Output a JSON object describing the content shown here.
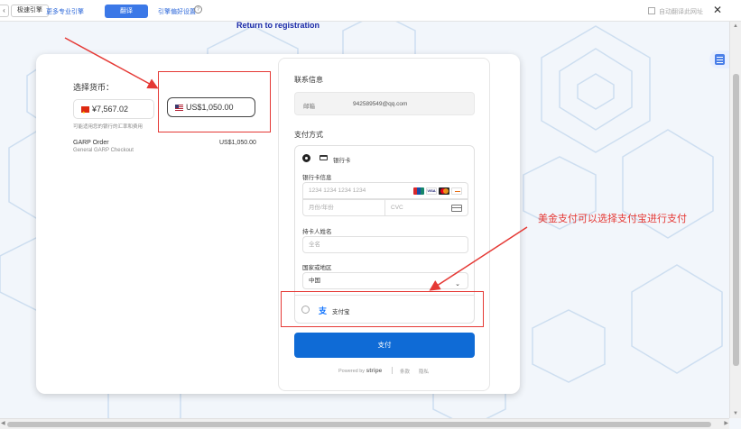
{
  "topbar": {
    "back_label": "‹",
    "engine_label": "极速引擎",
    "more_engines": "更多专业引擎",
    "translate_button": "翻译",
    "engine_settings": "引擎偏好设置",
    "help_glyph": "?",
    "auto_translate_label": "自动翻译此网址",
    "close_glyph": "✕"
  },
  "return_link": "Return to registration",
  "left_panel": {
    "currency_label": "选择货币：",
    "cny_value": "¥7,567.02",
    "usd_value": "US$1,050.00",
    "fx_note": "可能适用您的银行的汇率和费用",
    "order_name": "GARP Order",
    "order_desc": "General GARP Checkout",
    "order_price": "US$1,050.00"
  },
  "right_panel": {
    "contact_title": "联系信息",
    "email_label": "邮箱",
    "email_value": "942589549@qq.com",
    "payment_title": "支付方式",
    "bank_card_label": "银行卡",
    "card_info_label": "银行卡信息",
    "card_number_placeholder": "1234 1234 1234 1234",
    "expiry_placeholder": "月份/年份",
    "cvc_placeholder": "CVC",
    "cardholder_label": "持卡人姓名",
    "cardholder_placeholder": "全名",
    "country_label": "国家或地区",
    "country_value": "中国",
    "alipay_label": "支付宝",
    "pay_button": "支付",
    "powered_by": "Powered by",
    "stripe": "stripe",
    "terms": "条款",
    "privacy": "隐私"
  },
  "annotation": {
    "text": "美金支付可以选择支付宝进行支付",
    "color": "#e53935"
  },
  "colors": {
    "accent": "#0f6bd6",
    "translate_button": "#3b78e7"
  }
}
